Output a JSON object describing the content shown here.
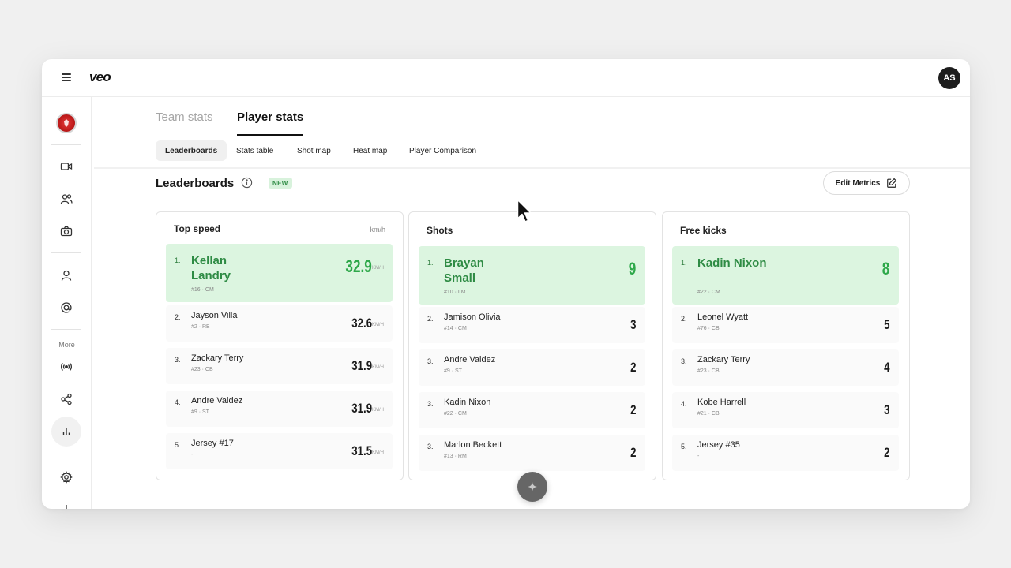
{
  "app": {
    "logo": "veo",
    "avatar_initials": "AS"
  },
  "sidebar": {
    "more_label": "More"
  },
  "tabs": {
    "team_stats": "Team stats",
    "player_stats": "Player stats"
  },
  "subtabs": [
    "Leaderboards",
    "Stats table",
    "Shot map",
    "Heat map",
    "Player Comparison"
  ],
  "leaderboards": {
    "title": "Leaderboards",
    "badge": "NEW",
    "edit_button": "Edit Metrics"
  },
  "cards": [
    {
      "title": "Top speed",
      "unit": "km/h",
      "rows": [
        {
          "rank": "1.",
          "name": "Kellan Landry",
          "info": "#16 · CM",
          "value": "32.9",
          "unit": "KM/H"
        },
        {
          "rank": "2.",
          "name": "Jayson Villa",
          "info": "#2 · RB",
          "value": "32.6",
          "unit": "KM/H"
        },
        {
          "rank": "3.",
          "name": "Zackary Terry",
          "info": "#23 · CB",
          "value": "31.9",
          "unit": "KM/H"
        },
        {
          "rank": "4.",
          "name": "Andre Valdez",
          "info": "#9 · ST",
          "value": "31.9",
          "unit": "KM/H"
        },
        {
          "rank": "5.",
          "name": "Jersey #17",
          "info": "-",
          "value": "31.5",
          "unit": "KM/H"
        }
      ]
    },
    {
      "title": "Shots",
      "unit": "",
      "rows": [
        {
          "rank": "1.",
          "name": "Brayan Small",
          "info": "#10 · LM",
          "value": "9",
          "unit": ""
        },
        {
          "rank": "2.",
          "name": "Jamison Olivia",
          "info": "#14 · CM",
          "value": "3",
          "unit": ""
        },
        {
          "rank": "3.",
          "name": "Andre Valdez",
          "info": "#9 · ST",
          "value": "2",
          "unit": ""
        },
        {
          "rank": "3.",
          "name": "Kadin Nixon",
          "info": "#22 · CM",
          "value": "2",
          "unit": ""
        },
        {
          "rank": "3.",
          "name": "Marlon Beckett",
          "info": "#13 · RM",
          "value": "2",
          "unit": ""
        }
      ]
    },
    {
      "title": "Free kicks",
      "unit": "",
      "rows": [
        {
          "rank": "1.",
          "name": "Kadin Nixon",
          "info": "#22 · CM",
          "value": "8",
          "unit": ""
        },
        {
          "rank": "2.",
          "name": "Leonel Wyatt",
          "info": "#76 · CB",
          "value": "5",
          "unit": ""
        },
        {
          "rank": "3.",
          "name": "Zackary Terry",
          "info": "#23 · CB",
          "value": "4",
          "unit": ""
        },
        {
          "rank": "4.",
          "name": "Kobe Harrell",
          "info": "#21 · CB",
          "value": "3",
          "unit": ""
        },
        {
          "rank": "5.",
          "name": "Jersey #35",
          "info": "-",
          "value": "2",
          "unit": ""
        }
      ]
    }
  ],
  "colors": {
    "accent_green": "#2ea84a",
    "highlight_bg": "#dcf5e0",
    "badge_bg": "#d8f2dc"
  }
}
